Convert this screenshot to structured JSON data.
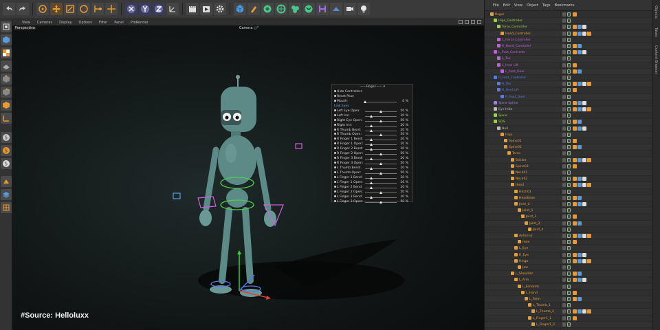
{
  "viewport": {
    "menu": [
      "View",
      "Cameras",
      "Display",
      "Options",
      "Filter",
      "Panel",
      "ProRender"
    ],
    "perspective_label": "Perspective",
    "camera_label": "Camera ○°"
  },
  "source_tag": "#Source: Helloluxx",
  "user_data_panel": {
    "title": "------Roger------ ▾",
    "rows": [
      {
        "label": "Hide Controllers",
        "kind": "button"
      },
      {
        "label": "Reset Pose",
        "kind": "button"
      },
      {
        "label": "Mouth:",
        "kind": "slider",
        "value": "0 %",
        "pos": 0.0
      },
      {
        "label": "Link Eyes",
        "kind": "link"
      },
      {
        "label": "Left Eye Open:",
        "kind": "slider",
        "value": "50 %",
        "pos": 0.5
      },
      {
        "label": "Left Iris:",
        "kind": "slider",
        "value": "20 %",
        "pos": 0.2
      },
      {
        "label": "Right Eye Open:",
        "kind": "slider",
        "value": "50 %",
        "pos": 0.5
      },
      {
        "label": "Right Iris:",
        "kind": "slider",
        "value": "20 %",
        "pos": 0.2
      },
      {
        "label": "R Thumb Bend:",
        "kind": "slider",
        "value": "20 %",
        "pos": 0.2
      },
      {
        "label": "R Thumb Open:",
        "kind": "slider",
        "value": "50 %",
        "pos": 0.5
      },
      {
        "label": "R Finger 1 Bend:",
        "kind": "slider",
        "value": "20 %",
        "pos": 0.2
      },
      {
        "label": "R Finger 1 Open:",
        "kind": "slider",
        "value": "20 %",
        "pos": 0.2
      },
      {
        "label": "R Finger 2 Bend:",
        "kind": "slider",
        "value": "20 %",
        "pos": 0.2
      },
      {
        "label": "R Finger 2 Open:",
        "kind": "slider",
        "value": "50 %",
        "pos": 0.5
      },
      {
        "label": "R Finger 3 Bend:",
        "kind": "slider",
        "value": "20 %",
        "pos": 0.2
      },
      {
        "label": "R Finger 3 Open:",
        "kind": "slider",
        "value": "50 %",
        "pos": 0.5
      },
      {
        "label": "L Thumb Bend:",
        "kind": "slider",
        "value": "20 %",
        "pos": 0.2
      },
      {
        "label": "L Thumb Open:",
        "kind": "slider",
        "value": "50 %",
        "pos": 0.5
      },
      {
        "label": "L Finger 1 Bend:",
        "kind": "slider",
        "value": "20 %",
        "pos": 0.2
      },
      {
        "label": "L Finger 1 Open:",
        "kind": "slider",
        "value": "20 %",
        "pos": 0.2
      },
      {
        "label": "L Finger 2 Bend:",
        "kind": "slider",
        "value": "20 %",
        "pos": 0.2
      },
      {
        "label": "L Finger 2 Open:",
        "kind": "slider",
        "value": "50 %",
        "pos": 0.5
      },
      {
        "label": "L Finger 3 Bend:",
        "kind": "slider",
        "value": "20 %",
        "pos": 0.2
      },
      {
        "label": "L Finger 3 Open:",
        "kind": "slider",
        "value": "50 %",
        "pos": 0.5
      }
    ]
  },
  "object_manager": {
    "menu": [
      "File",
      "Edit",
      "View",
      "Object",
      "Tags",
      "Bookmarks"
    ],
    "rows": [
      {
        "name": "Roger",
        "level": 0,
        "color": "#e0a040"
      },
      {
        "name": "Hips_Controller",
        "level": 1,
        "color": "#9ad04a"
      },
      {
        "name": "Torso_Controller",
        "level": 2,
        "color": "#9ad04a"
      },
      {
        "name": "Head_Controller",
        "level": 3,
        "color": "#e0a040"
      },
      {
        "name": "L_Hand_Controller",
        "level": 2,
        "color": "#c060e0"
      },
      {
        "name": "R_Hand_Controller",
        "level": 2,
        "color": "#c060e0"
      },
      {
        "name": "L_Foot_Controller",
        "level": 1,
        "color": "#c060e0"
      },
      {
        "name": "L_Toe",
        "level": 2,
        "color": "#c060e0"
      },
      {
        "name": "L_Heel Lift",
        "level": 2,
        "color": "#c060e0"
      },
      {
        "name": "L_Foot_Goal",
        "level": 3,
        "color": "#c060e0"
      },
      {
        "name": "R_Foot_Controller",
        "level": 1,
        "color": "#5a7ae0"
      },
      {
        "name": "R_Toe",
        "level": 2,
        "color": "#5a7ae0"
      },
      {
        "name": "R_Heel Lift",
        "level": 2,
        "color": "#5a7ae0"
      },
      {
        "name": "R_Foot_Goal",
        "level": 3,
        "color": "#5a7ae0"
      },
      {
        "name": "Spine Spline",
        "level": 1,
        "color": "#a080e0"
      },
      {
        "name": "Eye Hide",
        "level": 1,
        "color": "#bbbbbb"
      },
      {
        "name": "Spine",
        "level": 1,
        "color": "#9ad04a"
      },
      {
        "name": "SDS",
        "level": 1,
        "color": "#9ad04a"
      },
      {
        "name": "Null",
        "level": 2,
        "color": "#bbbbbb"
      },
      {
        "name": "Hips",
        "level": 3,
        "color": "#e0a040"
      },
      {
        "name": "Spine01",
        "level": 4,
        "color": "#e0a040"
      },
      {
        "name": "Spine02",
        "level": 4,
        "color": "#e0a040"
      },
      {
        "name": "Torso",
        "level": 5,
        "color": "#e0a040"
      },
      {
        "name": "Sticker",
        "level": 6,
        "color": "#e0a040"
      },
      {
        "name": "Spine03",
        "level": 6,
        "color": "#e0a040"
      },
      {
        "name": "Neck01",
        "level": 6,
        "color": "#e0a040"
      },
      {
        "name": "Neck02",
        "level": 6,
        "color": "#e0a040"
      },
      {
        "name": "Head",
        "level": 6,
        "color": "#e0a040"
      },
      {
        "name": "Hitch01",
        "level": 7,
        "color": "#e0a040"
      },
      {
        "name": "HeadBase",
        "level": 7,
        "color": "#e0a040"
      },
      {
        "name": "Joint_0",
        "level": 7,
        "color": "#e0a040"
      },
      {
        "name": "Joint_1",
        "level": 8,
        "color": "#e0a040"
      },
      {
        "name": "Joint_2",
        "level": 9,
        "color": "#e0a040"
      },
      {
        "name": "Joint_3",
        "level": 10,
        "color": "#e0a040"
      },
      {
        "name": "Joint_4",
        "level": 11,
        "color": "#e0a040"
      },
      {
        "name": "Antenna",
        "level": 7,
        "color": "#e0a040"
      },
      {
        "name": "Hole",
        "level": 8,
        "color": "#e0a040"
      },
      {
        "name": "L_Eye",
        "level": 7,
        "color": "#e0a040"
      },
      {
        "name": "R_Eye",
        "level": 7,
        "color": "#e0a040"
      },
      {
        "name": "Hinge",
        "level": 7,
        "color": "#e0a040"
      },
      {
        "name": "Jaw",
        "level": 8,
        "color": "#e0a040"
      },
      {
        "name": "L_Shoulder",
        "level": 6,
        "color": "#e0a040"
      },
      {
        "name": "L_Arm",
        "level": 7,
        "color": "#e0a040"
      },
      {
        "name": "L_Forearm",
        "level": 8,
        "color": "#e0a040"
      },
      {
        "name": "L_Hand",
        "level": 9,
        "color": "#e0a040"
      },
      {
        "name": "L_Palm",
        "level": 10,
        "color": "#e0a040"
      },
      {
        "name": "L_Thumb_1",
        "level": 11,
        "color": "#e0a040"
      },
      {
        "name": "L_Thumb_2",
        "level": 12,
        "color": "#e0a040"
      },
      {
        "name": "L_Finger1_1",
        "level": 11,
        "color": "#e0a040"
      },
      {
        "name": "L_Finger1_2",
        "level": 12,
        "color": "#e0a040"
      }
    ]
  },
  "side_tabs": [
    "Objects",
    "Takes",
    "Content Browser"
  ]
}
